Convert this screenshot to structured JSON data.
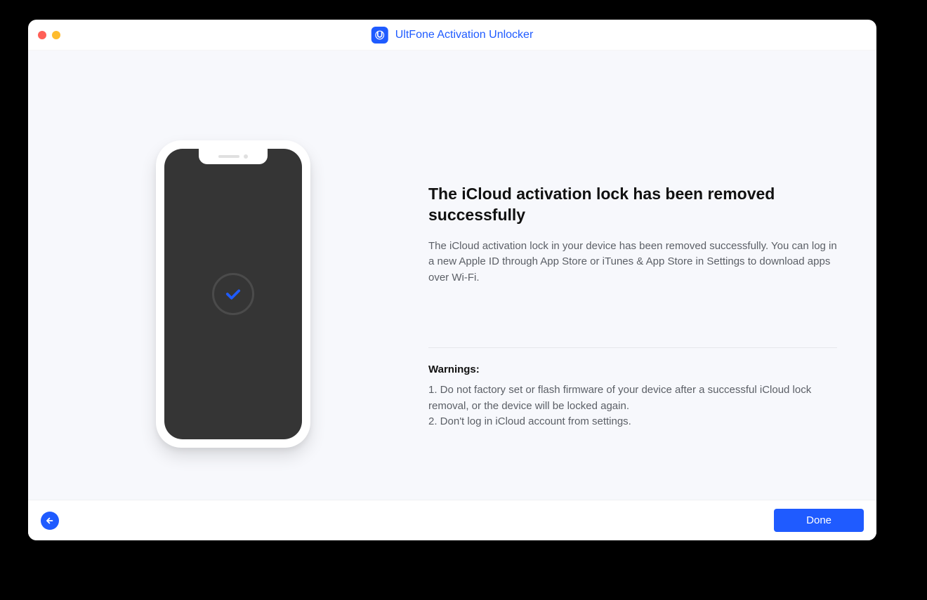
{
  "app": {
    "title": "UltFone Activation Unlocker"
  },
  "main": {
    "heading": "The iCloud activation lock has been removed successfully",
    "description": "The iCloud activation lock in your device has been removed successfully. You can log in a new Apple ID through App Store or iTunes & App Store in Settings to download apps over Wi-Fi.",
    "warnings_title": "Warnings:",
    "warning_1": "1. Do not factory set or flash firmware of your device after a successful iCloud lock removal, or the device will be locked again.",
    "warning_2": "2. Don't log in iCloud account from settings."
  },
  "footer": {
    "done_label": "Done"
  }
}
